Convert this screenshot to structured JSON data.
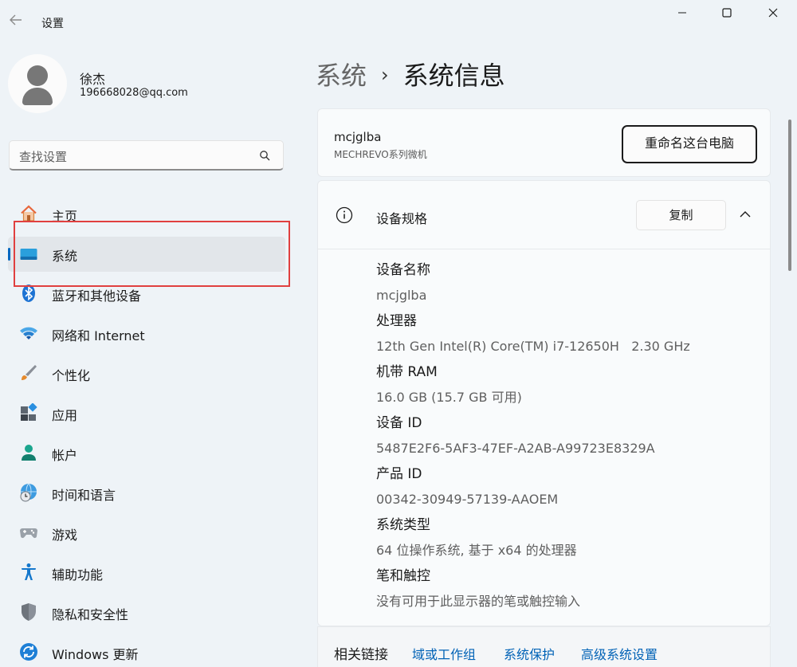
{
  "window": {
    "back_icon": "arrow-left-icon",
    "title": "设置",
    "controls": [
      "minimize-icon",
      "maximize-icon",
      "close-icon"
    ]
  },
  "user": {
    "name": "徐杰",
    "email": "196668028@qq.com"
  },
  "search": {
    "placeholder": "查找设置"
  },
  "sidebar": {
    "items": [
      {
        "label": "主页",
        "icon": "home-icon"
      },
      {
        "label": "系统",
        "icon": "system-display-icon",
        "active": true
      },
      {
        "label": "蓝牙和其他设备",
        "icon": "bluetooth-icon"
      },
      {
        "label": "网络和 Internet",
        "icon": "wifi-icon"
      },
      {
        "label": "个性化",
        "icon": "paintbrush-icon"
      },
      {
        "label": "应用",
        "icon": "apps-icon"
      },
      {
        "label": "帐户",
        "icon": "account-icon"
      },
      {
        "label": "时间和语言",
        "icon": "globe-clock-icon"
      },
      {
        "label": "游戏",
        "icon": "gamepad-icon"
      },
      {
        "label": "辅助功能",
        "icon": "accessibility-icon"
      },
      {
        "label": "隐私和安全性",
        "icon": "shield-icon"
      },
      {
        "label": "Windows 更新",
        "icon": "update-icon"
      }
    ]
  },
  "breadcrumb": {
    "parent": "系统",
    "separator": "›",
    "current": "系统信息"
  },
  "pc": {
    "name": "mcjglba",
    "model": "MECHREVO系列微机",
    "rename_label": "重命名这台电脑"
  },
  "specs": {
    "title": "设备规格",
    "copy_label": "复制",
    "items": [
      {
        "label": "设备名称",
        "value": "mcjglba"
      },
      {
        "label": "处理器",
        "value": "12th Gen Intel(R) Core(TM) i7-12650H   2.30 GHz"
      },
      {
        "label": "机带 RAM",
        "value": "16.0 GB (15.7 GB 可用)"
      },
      {
        "label": "设备 ID",
        "value": "5487E2F6-5AF3-47EF-A2AB-A99723E8329A"
      },
      {
        "label": "产品 ID",
        "value": "00342-30949-57139-AAOEM"
      },
      {
        "label": "系统类型",
        "value": "64 位操作系统, 基于 x64 的处理器"
      },
      {
        "label": "笔和触控",
        "value": "没有可用于此显示器的笔或触控输入"
      }
    ]
  },
  "related": {
    "label": "相关链接",
    "links": [
      "域或工作组",
      "系统保护",
      "高级系统设置"
    ]
  },
  "colors": {
    "accent": "#0067c0",
    "link": "#0062b6",
    "highlight_box": "#e0403f"
  }
}
